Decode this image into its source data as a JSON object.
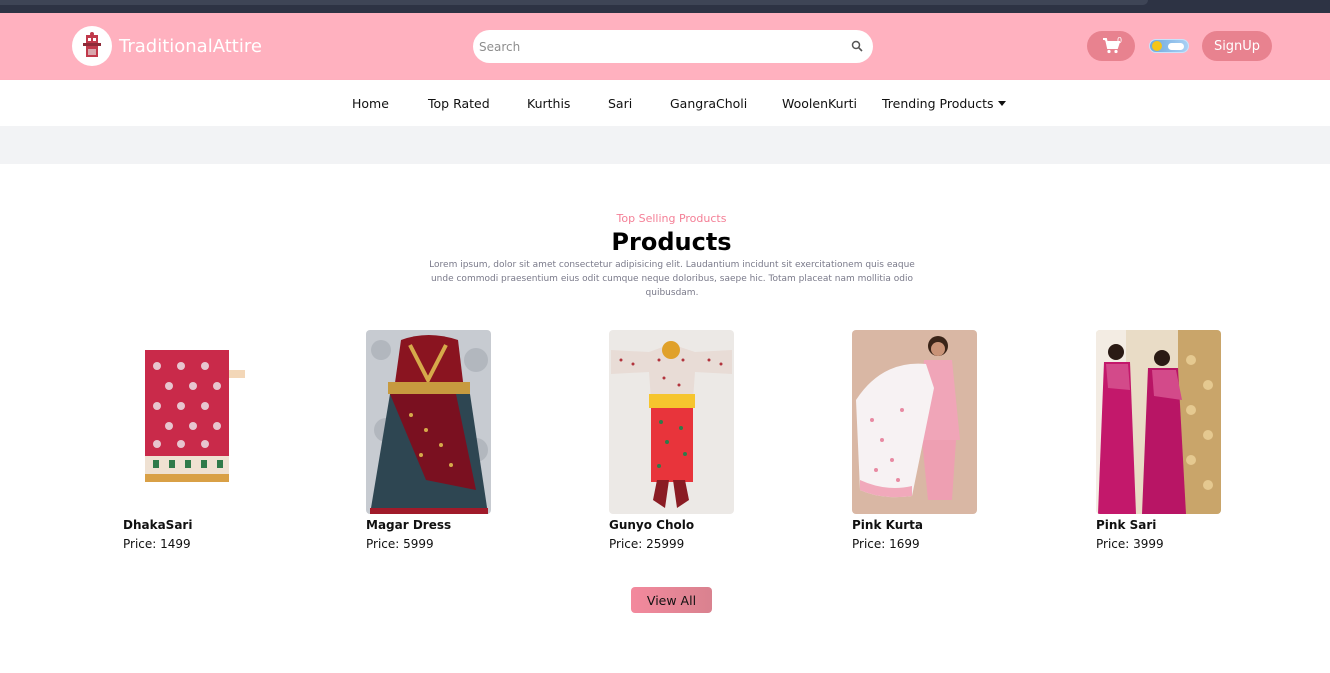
{
  "header": {
    "brand": "TraditionalAttire",
    "search_placeholder": "Search",
    "cart_count": "0",
    "signup_label": "SignUp"
  },
  "nav": {
    "items": [
      "Home",
      "Top Rated",
      "Kurthis",
      "Sari",
      "GangraCholi",
      "WoolenKurti",
      "Trending Products"
    ]
  },
  "section": {
    "kicker": "Top Selling Products",
    "title": "Products",
    "description": "Lorem ipsum, dolor sit amet consectetur adipisicing elit. Laudantium incidunt sit exercitationem quis eaque unde commodi praesentium eius odit cumque neque doloribus, saepe hic. Totam placeat nam mollitia odio quibusdam."
  },
  "products": [
    {
      "name": "DhakaSari",
      "price": "Price: 1499"
    },
    {
      "name": "Magar Dress",
      "price": "Price: 5999"
    },
    {
      "name": "Gunyo Cholo",
      "price": "Price: 25999"
    },
    {
      "name": "Pink Kurta",
      "price": "Price: 1699"
    },
    {
      "name": "Pink Sari",
      "price": "Price: 3999"
    }
  ],
  "view_all_label": "View All",
  "colors": {
    "header_bg": "#ffb1bf",
    "accent": "#e8828f",
    "kicker": "#f47f96"
  }
}
